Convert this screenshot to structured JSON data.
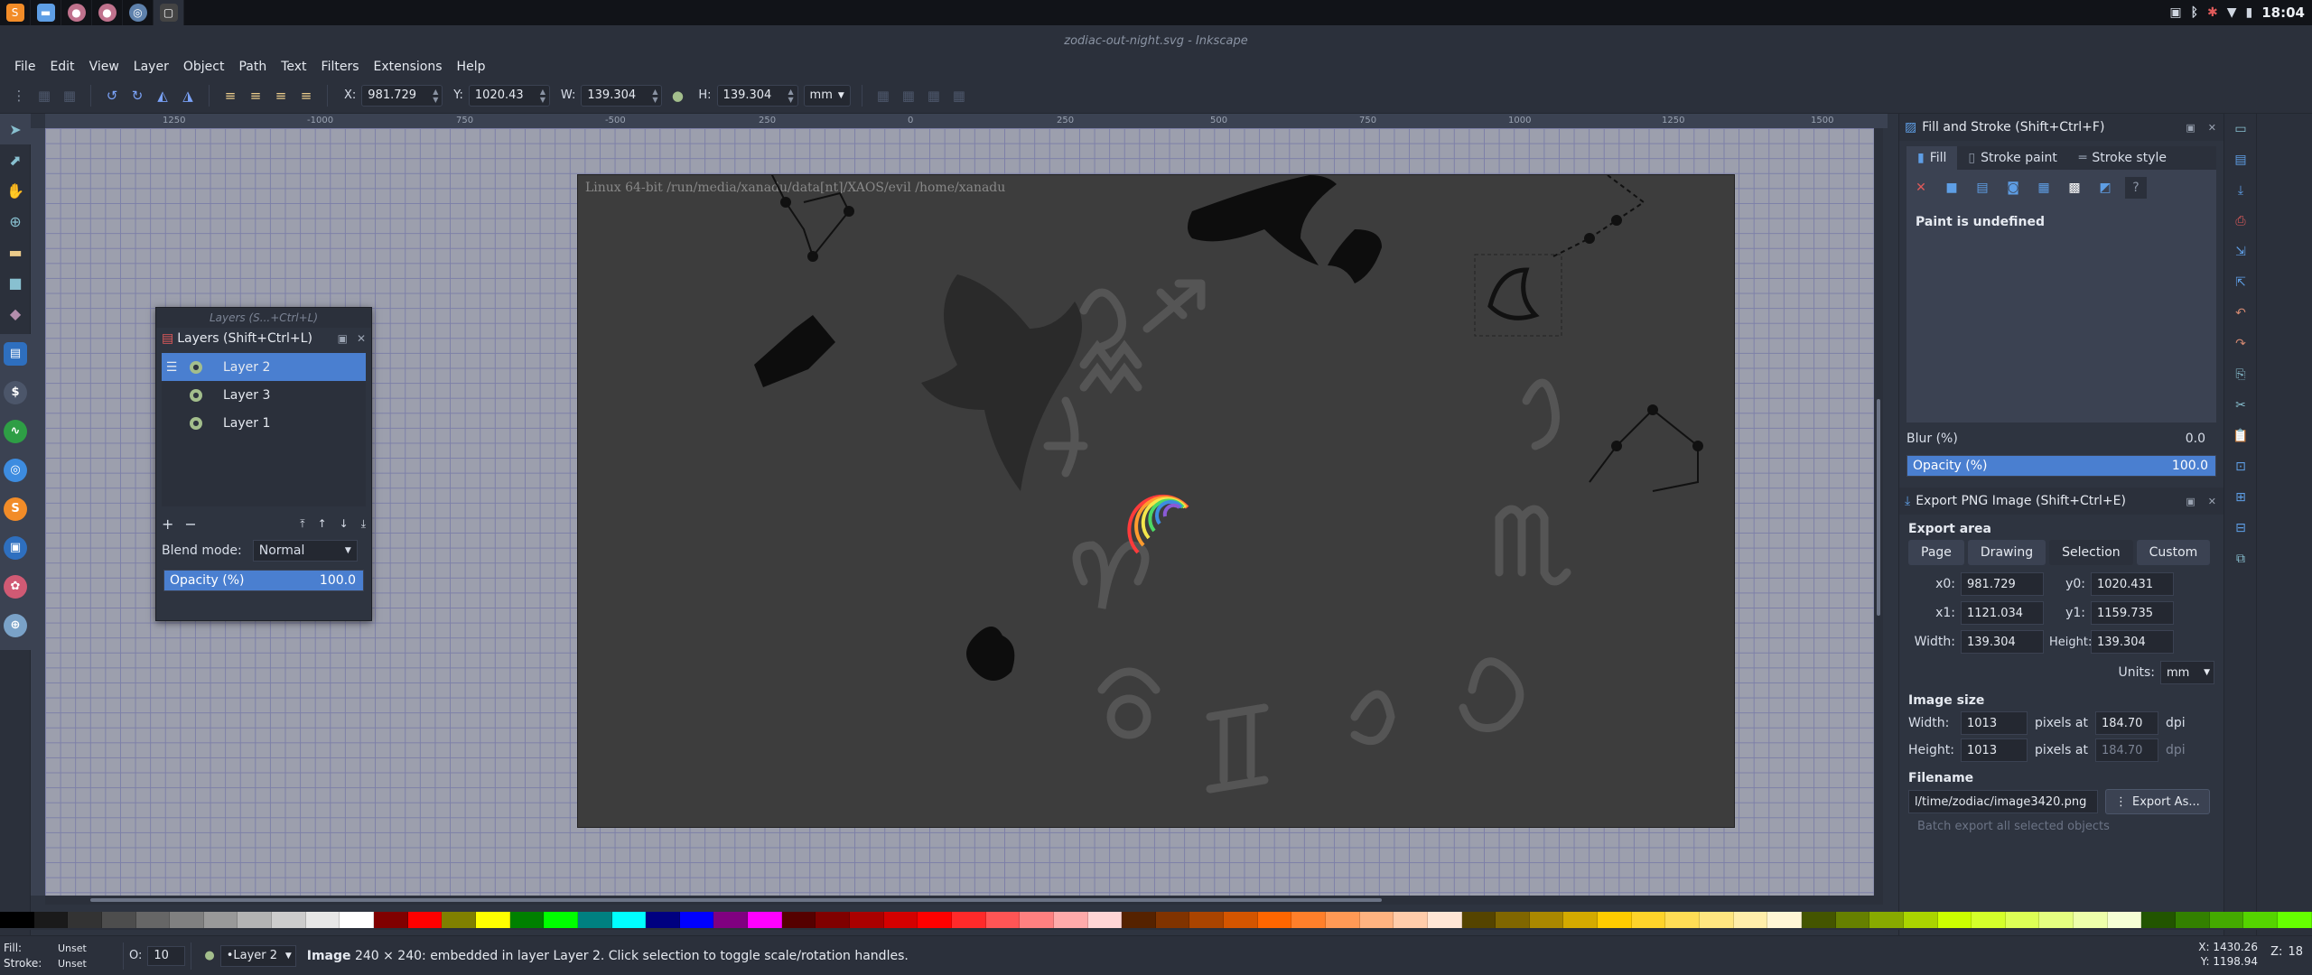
{
  "window": {
    "title": "zodiac-out-night.svg - Inkscape",
    "clock": "18:04",
    "tray_icons": [
      "window-icon",
      "bluetooth-icon",
      "network-icon",
      "wifi-icon",
      "battery-icon"
    ]
  },
  "menus": [
    "File",
    "Edit",
    "View",
    "Layer",
    "Object",
    "Path",
    "Text",
    "Filters",
    "Extensions",
    "Help"
  ],
  "toolbar": {
    "x_label": "X:",
    "x_value": "981.729",
    "y_label": "Y:",
    "y_value": "1020.43",
    "w_label": "W:",
    "w_value": "139.304",
    "h_label": "H:",
    "h_value": "139.304",
    "units": "mm"
  },
  "rulers": {
    "h_ticks": [
      "1250",
      "-1000",
      "750",
      "-500",
      "250",
      "0",
      "250",
      "500",
      "750",
      "1000",
      "1250",
      "1500"
    ]
  },
  "canvas": {
    "page_caption": "Linux 64-bit /run/media/xanadu/data[nt]/XAOS/evil /home/xanadu",
    "background_color": "#9c9fad",
    "page_color": "#3d3d3d"
  },
  "layers_panel": {
    "float_title": "Layers (S...+Ctrl+L)",
    "title": "Layers (Shift+Ctrl+L)",
    "layers": [
      {
        "name": "Layer 2",
        "selected": true
      },
      {
        "name": "Layer 3",
        "selected": false
      },
      {
        "name": "Layer 1",
        "selected": false
      }
    ],
    "blend_label": "Blend mode:",
    "blend_value": "Normal",
    "opacity_label": "Opacity (%)",
    "opacity_value": "100.0",
    "opacity_fraction": 1.0
  },
  "fill_stroke": {
    "title": "Fill and Stroke (Shift+Ctrl+F)",
    "tabs": [
      "Fill",
      "Stroke paint",
      "Stroke style"
    ],
    "active_tab": "Fill",
    "paint_status": "Paint is undefined",
    "blur_label": "Blur (%)",
    "blur_value": "0.0",
    "opacity_label": "Opacity (%)",
    "opacity_value": "100.0",
    "opacity_fraction": 1.0
  },
  "export": {
    "title": "Export PNG Image (Shift+Ctrl+E)",
    "area_label": "Export area",
    "area_tabs": [
      "Page",
      "Drawing",
      "Selection",
      "Custom"
    ],
    "active_area": "Selection",
    "x0_label": "x0:",
    "x0": "981.729",
    "y0_label": "y0:",
    "y0": "1020.431",
    "x1_label": "x1:",
    "x1": "1121.034",
    "y1_label": "y1:",
    "y1": "1159.735",
    "width_label": "Width:",
    "width": "139.304",
    "height_label": "Height:",
    "height": "139.304",
    "units_label": "Units:",
    "units": "mm",
    "image_size_label": "Image size",
    "img_width_label": "Width:",
    "img_width": "1013",
    "img_height_label": "Height:",
    "img_height": "1013",
    "pixels_at": "pixels at",
    "dpi_value": "184.70",
    "dpi_value_2": "184.70",
    "dpi_label": "dpi",
    "filename_label": "Filename",
    "filename": "l/time/zodiac/image3420.png",
    "export_as": "Export As...",
    "batch_label": "Batch export all selected objects"
  },
  "status": {
    "fill_label": "Fill:",
    "fill_value": "Unset",
    "stroke_label": "Stroke:",
    "stroke_value": "Unset",
    "o_label": "O:",
    "o_value": "10",
    "layer_value": "•Layer 2",
    "message_bold": "Image",
    "message": "240 × 240: embedded in layer Layer 2. Click selection to toggle scale/rotation handles.",
    "x_coord": "X: 1430.26",
    "y_coord": "Y: 1198.94",
    "zoom_label": "Z:",
    "zoom_value": "18"
  },
  "colors": {
    "accent": "#4a7fd0",
    "palette": [
      "#000000",
      "#1a1a1a",
      "#333333",
      "#4d4d4d",
      "#666666",
      "#808080",
      "#999999",
      "#b3b3b3",
      "#cccccc",
      "#e6e6e6",
      "#ffffff",
      "#800000",
      "#ff0000",
      "#808000",
      "#ffff00",
      "#008000",
      "#00ff00",
      "#008080",
      "#00ffff",
      "#000080",
      "#0000ff",
      "#800080",
      "#ff00ff",
      "#550000",
      "#800000",
      "#aa0000",
      "#d40000",
      "#ff0000",
      "#ff2a2a",
      "#ff5555",
      "#ff8080",
      "#ffaaaa",
      "#ffd5d5",
      "#552200",
      "#803300",
      "#aa4400",
      "#d45500",
      "#ff6600",
      "#ff7f2a",
      "#ff9955",
      "#ffb380",
      "#ffccaa",
      "#ffe6d5",
      "#554400",
      "#806600",
      "#aa8800",
      "#d4aa00",
      "#ffcc00",
      "#ffd42a",
      "#ffdd55",
      "#ffe680",
      "#ffeeaa",
      "#fff6d5",
      "#445500",
      "#668000",
      "#88aa00",
      "#aad400",
      "#ccff00",
      "#d4ff2a",
      "#ddff55",
      "#e5ff80",
      "#eeffaa",
      "#f6ffd5",
      "#225500",
      "#338000",
      "#44aa00",
      "#55d400",
      "#66ff00"
    ]
  }
}
